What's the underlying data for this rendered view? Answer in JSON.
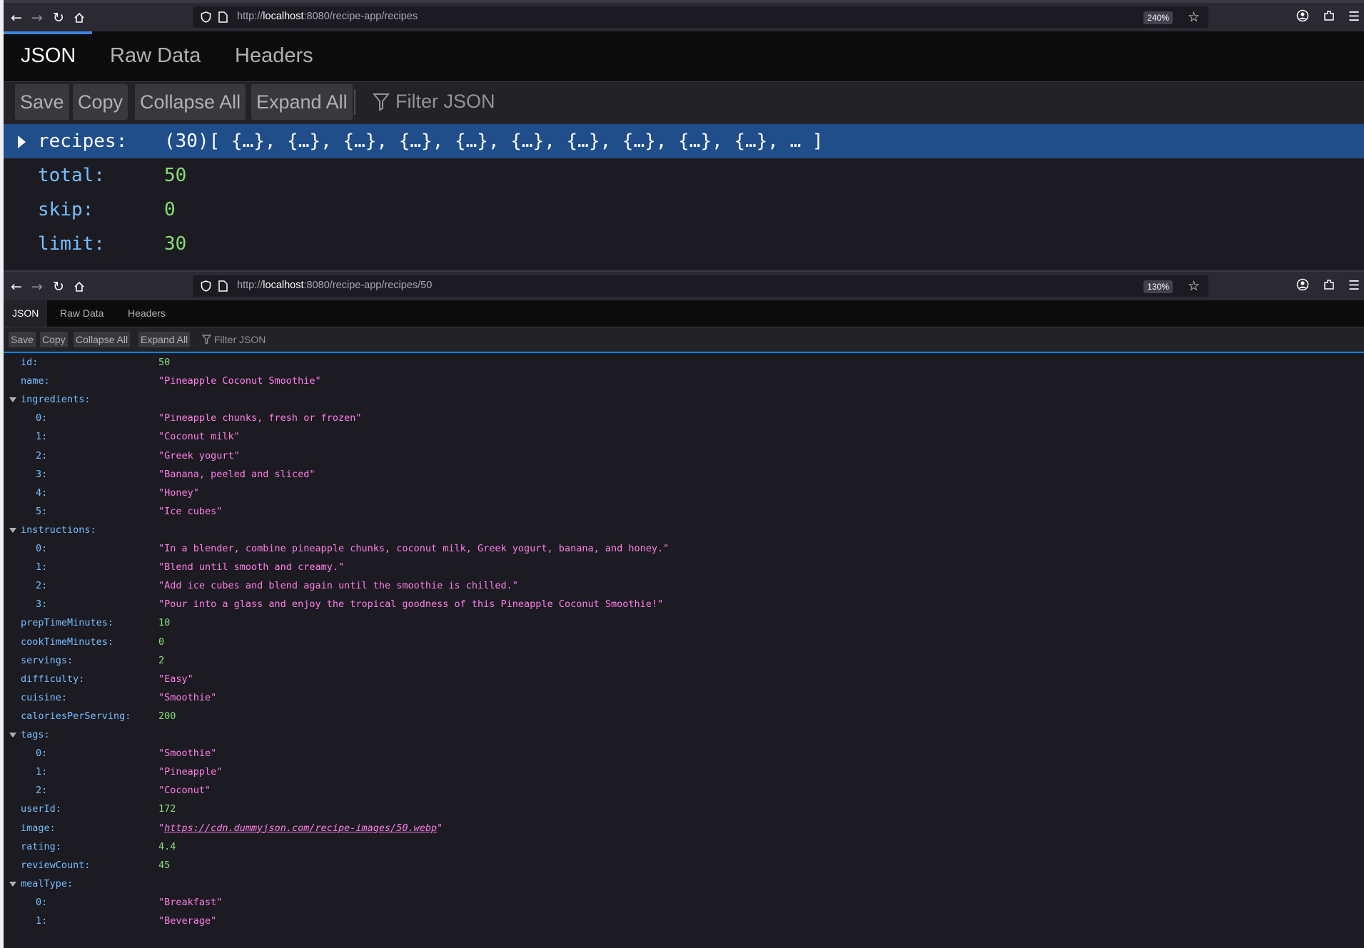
{
  "windows": [
    {
      "url_prefix": "http://",
      "url_host": "localhost",
      "url_rest": ":8080/recipe-app/recipes",
      "zoom": "240%",
      "tabs": [
        "JSON",
        "Raw Data",
        "Headers"
      ],
      "toolbar": {
        "save": "Save",
        "copy": "Copy",
        "collapse_all": "Collapse All",
        "expand_all": "Expand All",
        "filter_placeholder": "Filter JSON"
      },
      "rows": [
        {
          "key": "recipes:",
          "value": "(30)[ {…}, {…}, {…}, {…}, {…}, {…}, {…}, {…}, {…}, {…}, … ]",
          "type": "array-collapsed"
        },
        {
          "key": "total:",
          "value": "50",
          "type": "number"
        },
        {
          "key": "skip:",
          "value": "0",
          "type": "number"
        },
        {
          "key": "limit:",
          "value": "30",
          "type": "number"
        }
      ]
    },
    {
      "url_prefix": "http://",
      "url_host": "localhost",
      "url_rest": ":8080/recipe-app/recipes/50",
      "zoom": "130%",
      "tabs": [
        "JSON",
        "Raw Data",
        "Headers"
      ],
      "toolbar": {
        "save": "Save",
        "copy": "Copy",
        "collapse_all": "Collapse All",
        "expand_all": "Expand All",
        "filter_placeholder": "Filter JSON"
      },
      "rows": [
        {
          "key": "id:",
          "value": "50",
          "type": "number",
          "level": 0
        },
        {
          "key": "name:",
          "value": "\"Pineapple Coconut Smoothie\"",
          "type": "string",
          "level": 0
        },
        {
          "key": "ingredients:",
          "value": "",
          "type": "expanded",
          "level": 0
        },
        {
          "key": "0:",
          "value": "\"Pineapple chunks, fresh or frozen\"",
          "type": "string",
          "level": 1
        },
        {
          "key": "1:",
          "value": "\"Coconut milk\"",
          "type": "string",
          "level": 1
        },
        {
          "key": "2:",
          "value": "\"Greek yogurt\"",
          "type": "string",
          "level": 1
        },
        {
          "key": "3:",
          "value": "\"Banana, peeled and sliced\"",
          "type": "string",
          "level": 1
        },
        {
          "key": "4:",
          "value": "\"Honey\"",
          "type": "string",
          "level": 1
        },
        {
          "key": "5:",
          "value": "\"Ice cubes\"",
          "type": "string",
          "level": 1
        },
        {
          "key": "instructions:",
          "value": "",
          "type": "expanded",
          "level": 0
        },
        {
          "key": "0:",
          "value": "\"In a blender, combine pineapple chunks, coconut milk, Greek yogurt, banana, and honey.\"",
          "type": "string",
          "level": 1
        },
        {
          "key": "1:",
          "value": "\"Blend until smooth and creamy.\"",
          "type": "string",
          "level": 1
        },
        {
          "key": "2:",
          "value": "\"Add ice cubes and blend again until the smoothie is chilled.\"",
          "type": "string",
          "level": 1
        },
        {
          "key": "3:",
          "value": "\"Pour into a glass and enjoy the tropical goodness of this Pineapple Coconut Smoothie!\"",
          "type": "string",
          "level": 1
        },
        {
          "key": "prepTimeMinutes:",
          "value": "10",
          "type": "number",
          "level": 0
        },
        {
          "key": "cookTimeMinutes:",
          "value": "0",
          "type": "number",
          "level": 0
        },
        {
          "key": "servings:",
          "value": "2",
          "type": "number",
          "level": 0
        },
        {
          "key": "difficulty:",
          "value": "\"Easy\"",
          "type": "string",
          "level": 0
        },
        {
          "key": "cuisine:",
          "value": "\"Smoothie\"",
          "type": "string",
          "level": 0
        },
        {
          "key": "caloriesPerServing:",
          "value": "200",
          "type": "number",
          "level": 0
        },
        {
          "key": "tags:",
          "value": "",
          "type": "expanded",
          "level": 0
        },
        {
          "key": "0:",
          "value": "\"Smoothie\"",
          "type": "string",
          "level": 1
        },
        {
          "key": "1:",
          "value": "\"Pineapple\"",
          "type": "string",
          "level": 1
        },
        {
          "key": "2:",
          "value": "\"Coconut\"",
          "type": "string",
          "level": 1
        },
        {
          "key": "userId:",
          "value": "172",
          "type": "number",
          "level": 0
        },
        {
          "key": "image:",
          "value": "https://cdn.dummyjson.com/recipe-images/50.webp",
          "type": "link",
          "level": 0
        },
        {
          "key": "rating:",
          "value": "4.4",
          "type": "number",
          "level": 0
        },
        {
          "key": "reviewCount:",
          "value": "45",
          "type": "number",
          "level": 0
        },
        {
          "key": "mealType:",
          "value": "",
          "type": "expanded",
          "level": 0
        },
        {
          "key": "0:",
          "value": "\"Breakfast\"",
          "type": "string",
          "level": 1
        },
        {
          "key": "1:",
          "value": "\"Beverage\"",
          "type": "string",
          "level": 1
        }
      ]
    }
  ],
  "colors": {
    "key": "#75bfff",
    "number": "#86de74",
    "string": "#ff7de9",
    "selected_row": "#204e8a",
    "accent": "#0a84ff"
  },
  "icons": [
    "back-icon",
    "forward-icon",
    "reload-icon",
    "home-icon",
    "shield-icon",
    "page-icon",
    "star-icon",
    "account-icon",
    "extensions-icon",
    "menu-icon",
    "filter-icon"
  ]
}
